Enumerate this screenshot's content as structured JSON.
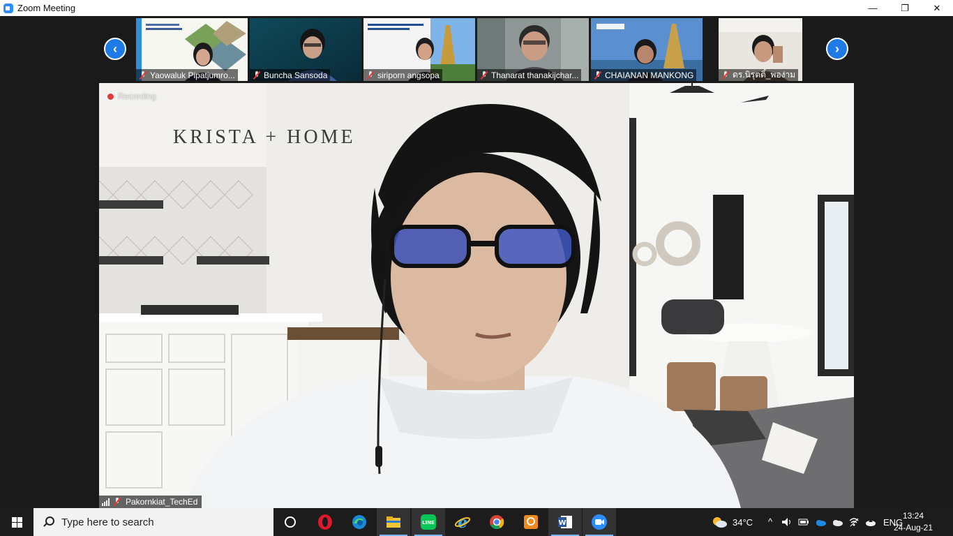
{
  "window": {
    "title": "Zoom Meeting",
    "minimize_glyph": "—",
    "restore_glyph": "❐",
    "close_glyph": "✕"
  },
  "gallery": {
    "prev_glyph": "‹",
    "next_glyph": "›",
    "participants": [
      {
        "name": "Yaowaluk Pipatjumro...",
        "muted": true
      },
      {
        "name": "Buncha Sansoda",
        "muted": true
      },
      {
        "name": "siriporn angsopa",
        "muted": true
      },
      {
        "name": "Thanarat thanakijchar...",
        "muted": true
      },
      {
        "name": "CHAIANAN MANKONG",
        "muted": true
      },
      {
        "name": "ดร.นิรุตติ์_พอง่าม",
        "muted": true
      }
    ]
  },
  "main_video": {
    "recording_label": "Recording",
    "background_brand": "KRISTA + HOME",
    "speaker_name": "Pakornkiat_TechEd",
    "speaker_muted": true
  },
  "taskbar": {
    "search_placeholder": "Type here to search",
    "apps": [
      "task-view",
      "opera",
      "edge",
      "file-explorer",
      "line",
      "internet-explorer",
      "chrome",
      "foxit-pdf",
      "word",
      "zoom"
    ],
    "weather_temp": "34°C",
    "language": "ENG",
    "time": "13:24",
    "date": "24-Aug-21"
  },
  "colors": {
    "zoom_blue": "#2d8cff",
    "nav_arrow": "#1e7be6",
    "muted_red": "#e33333",
    "taskbar": "#1c1c1c"
  }
}
